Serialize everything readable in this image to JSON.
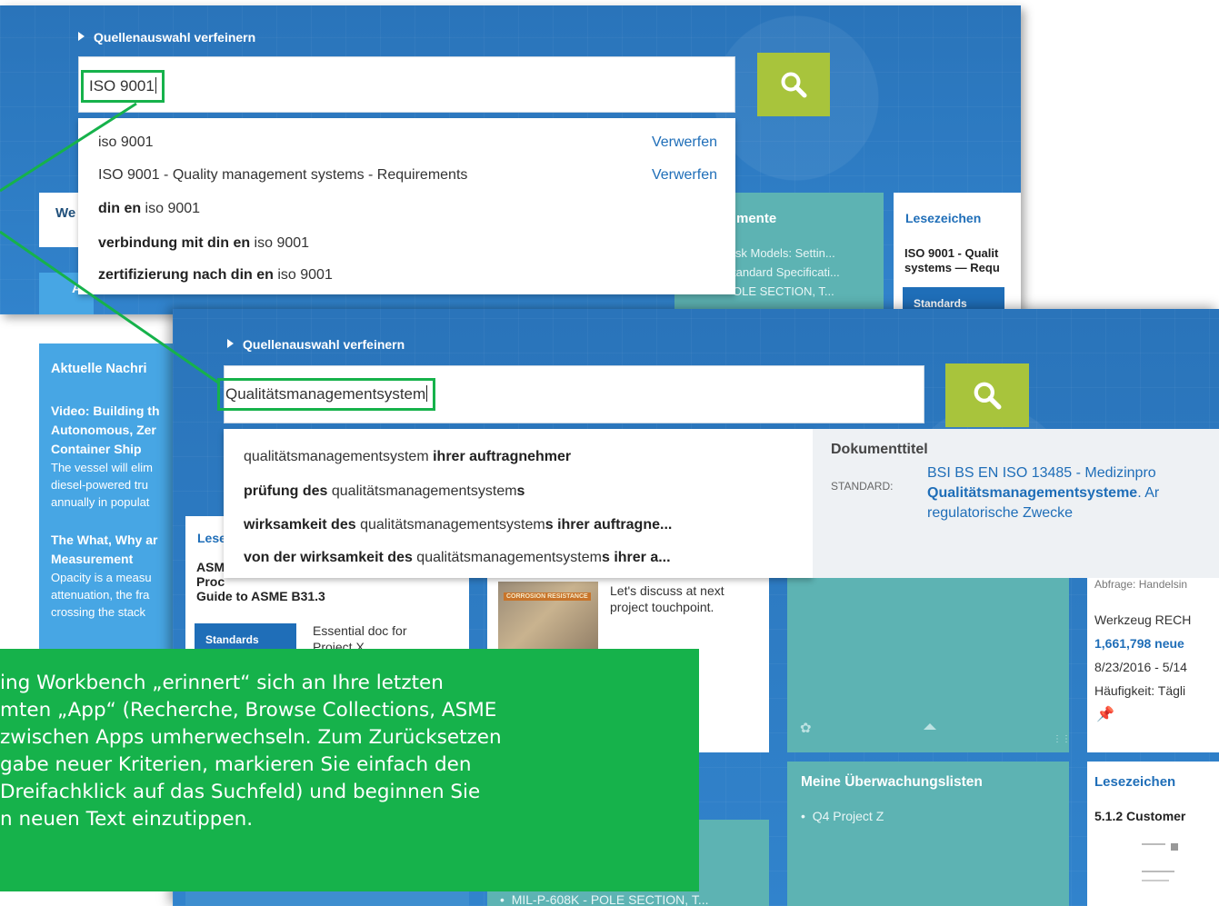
{
  "back": {
    "refine_label": "Quellenauswahl verfeinern",
    "search_value": "ISO 9001",
    "suggestions": [
      {
        "pre": "",
        "bold": "",
        "term": "iso 9001",
        "action": "Verwerfen"
      },
      {
        "pre": "",
        "bold": "",
        "term": "ISO 9001 - Quality management systems - Requirements",
        "action": "Verwerfen"
      },
      {
        "bold": "din en",
        "term": " iso 9001",
        "action": ""
      },
      {
        "bold": "verbindung mit din en",
        "term": " iso 9001",
        "action": ""
      },
      {
        "bold": "zertifizierung nach din en",
        "term": " iso 9001",
        "action": ""
      }
    ],
    "tile_left_title": "We",
    "tile_mid_title": "mente",
    "tile_mid_lines": [
      "isk Models: Settin...",
      "tandard Specificati...",
      "OLE SECTION, T..."
    ],
    "bookmarks_title": "Lesezeichen",
    "bookmarks_doc": [
      "ISO 9001 - Qualit",
      "systems — Requ"
    ],
    "bookmarks_tag": "Standards",
    "about_fragment": "Abo"
  },
  "front": {
    "refine_label": "Quellenauswahl verfeinern",
    "search_value": "Qualitätsmanagementsystem",
    "suggestions": [
      {
        "a": "qualitätsmanagementsystem",
        "b": " ihrer auftragnehmer",
        "c": "",
        "d": ""
      },
      {
        "a": "",
        "b": "prüfung des",
        "c": " qualitätsmanagementsystem",
        "d": "s"
      },
      {
        "a": "",
        "b": "wirksamkeit des",
        "c": " qualitätsmanagementsystem",
        "d": "s ihrer auftragne..."
      },
      {
        "a": "",
        "b": "von der wirksamkeit des",
        "c": " qualitätsmanagementsystem",
        "d": "s ihrer a..."
      }
    ],
    "doc_panel": {
      "title": "Dokumenttitel",
      "type_label": "STANDARD:",
      "line1": "BSI BS EN ISO 13485 - Medizinpro",
      "line2_bold": "Qualitätsmanagementsysteme",
      "line2_rest": ". Ar",
      "line3": "regulatorische Zwecke"
    },
    "news": {
      "title": "Aktuelle Nachri",
      "item1_title": [
        "Video: Building th",
        "Autonomous, Zer",
        "Container Ship"
      ],
      "item1_body": [
        "The vessel will elim",
        "diesel-powered tru",
        "annually in populat"
      ],
      "item2_title": [
        "The What, Why ar",
        "Measurement"
      ],
      "item2_body": [
        "Opacity is a measu",
        "attenuation, the fra",
        "crossing the stack"
      ]
    },
    "bookmark_card": {
      "title": "Lese",
      "doc": [
        "ASM",
        "Proc",
        "Guide to ASME B31.3"
      ],
      "tag": "Standards",
      "note": [
        "Essential doc for",
        "Project X"
      ]
    },
    "mid_card": {
      "caption": [
        "Let's discuss at next",
        "project touchpoint."
      ],
      "image_label": "CORROSION RESISTANCE"
    },
    "right_card": {
      "lines": [
        "Abfrage: Handelsin",
        "Werkzeug RECH"
      ],
      "count": "1,661,798 neue",
      "date": "8/23/2016 - 5/14",
      "freq": "Häufigkeit: Tägli"
    },
    "watchlists": {
      "title": "Meine Überwachungslisten",
      "item": "Q4 Project Z"
    },
    "bookmarks2": {
      "title": "Lesezeichen",
      "doc": "5.1.2 Customer"
    },
    "bottom_item": "MIL-P-608K - POLE SECTION, T..."
  },
  "callout": {
    "lines": [
      "ing Workbench „erinnert“ sich an Ihre letzten",
      "mten „App“ (Recherche, Browse Collections, ASME",
      "zwischen Apps umherwechseln. Zum Zurücksetzen",
      "gabe neuer Kriterien, markieren Sie einfach den",
      "Dreifachklick auf das Suchfeld) und beginnen Sie",
      "n neuen Text einzutippen."
    ]
  },
  "colors": {
    "accent_green": "#16b24b",
    "search_button": "#a8c43c",
    "background_blue": "#2e7bc4",
    "link_blue": "#1f6eb8"
  },
  "icons": {
    "search": "search-icon",
    "refine": "triangle-right-icon",
    "palette": "palette-icon",
    "pin": "pin-icon",
    "resize": "resize-grip-icon"
  }
}
